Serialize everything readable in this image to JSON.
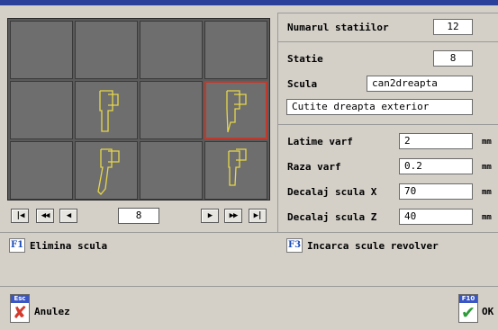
{
  "header": {
    "accent_color": "#2a3f9a"
  },
  "tool_grid": {
    "selected_color": "#c0392b",
    "tool_color": "#e6d64a",
    "cells": [
      {
        "tool": ""
      },
      {
        "tool": ""
      },
      {
        "tool": ""
      },
      {
        "tool": ""
      },
      {
        "tool": "holder-straight"
      },
      {
        "tool": ""
      },
      {
        "tool": "holder-right-selected"
      },
      {
        "tool": ""
      },
      {
        "tool": "holder-angled"
      },
      {
        "tool": ""
      },
      {
        "tool": "holder-straight-small"
      },
      {
        "tool": ""
      }
    ]
  },
  "nav": {
    "first_icon": "skip-first-icon",
    "fast_back_icon": "fast-back-icon",
    "back_icon": "step-back-icon",
    "page_value": "8",
    "forward_icon": "step-forward-icon",
    "fast_forward_icon": "fast-forward-icon",
    "last_icon": "skip-last-icon",
    "first_glyph": "|◀",
    "fast_back_glyph": "◀◀",
    "back_glyph": "◀",
    "forward_glyph": "▶",
    "fast_forward_glyph": "▶▶",
    "last_glyph": "▶|"
  },
  "stations": {
    "label": "Numarul statiilor",
    "value": "12"
  },
  "station": {
    "label": "Statie",
    "value": "8",
    "tool_label": "Scula",
    "tool_value": "can2dreapta",
    "description": "Cutite dreapta exterior"
  },
  "params": [
    {
      "label": "Latime varf",
      "value": "2",
      "unit": "mm"
    },
    {
      "label": "Raza varf",
      "value": "0.2",
      "unit": "mm"
    },
    {
      "label": "Decalaj scula X",
      "value": "70",
      "unit": "mm"
    },
    {
      "label": "Decalaj scula Z",
      "value": "40",
      "unit": "mm"
    }
  ],
  "fkeys": {
    "f1_key": "F1",
    "f1_label": "Elimina scula",
    "f3_key": "F3",
    "f3_label": "Incarca scule revolver"
  },
  "footer": {
    "cancel_key": "Esc",
    "cancel_label": "Anulez",
    "cancel_icon": "x-mark-icon",
    "cancel_glyph": "✘",
    "ok_key": "F10",
    "ok_label": "OK",
    "ok_icon": "checkmark-icon",
    "ok_glyph": "✔"
  }
}
